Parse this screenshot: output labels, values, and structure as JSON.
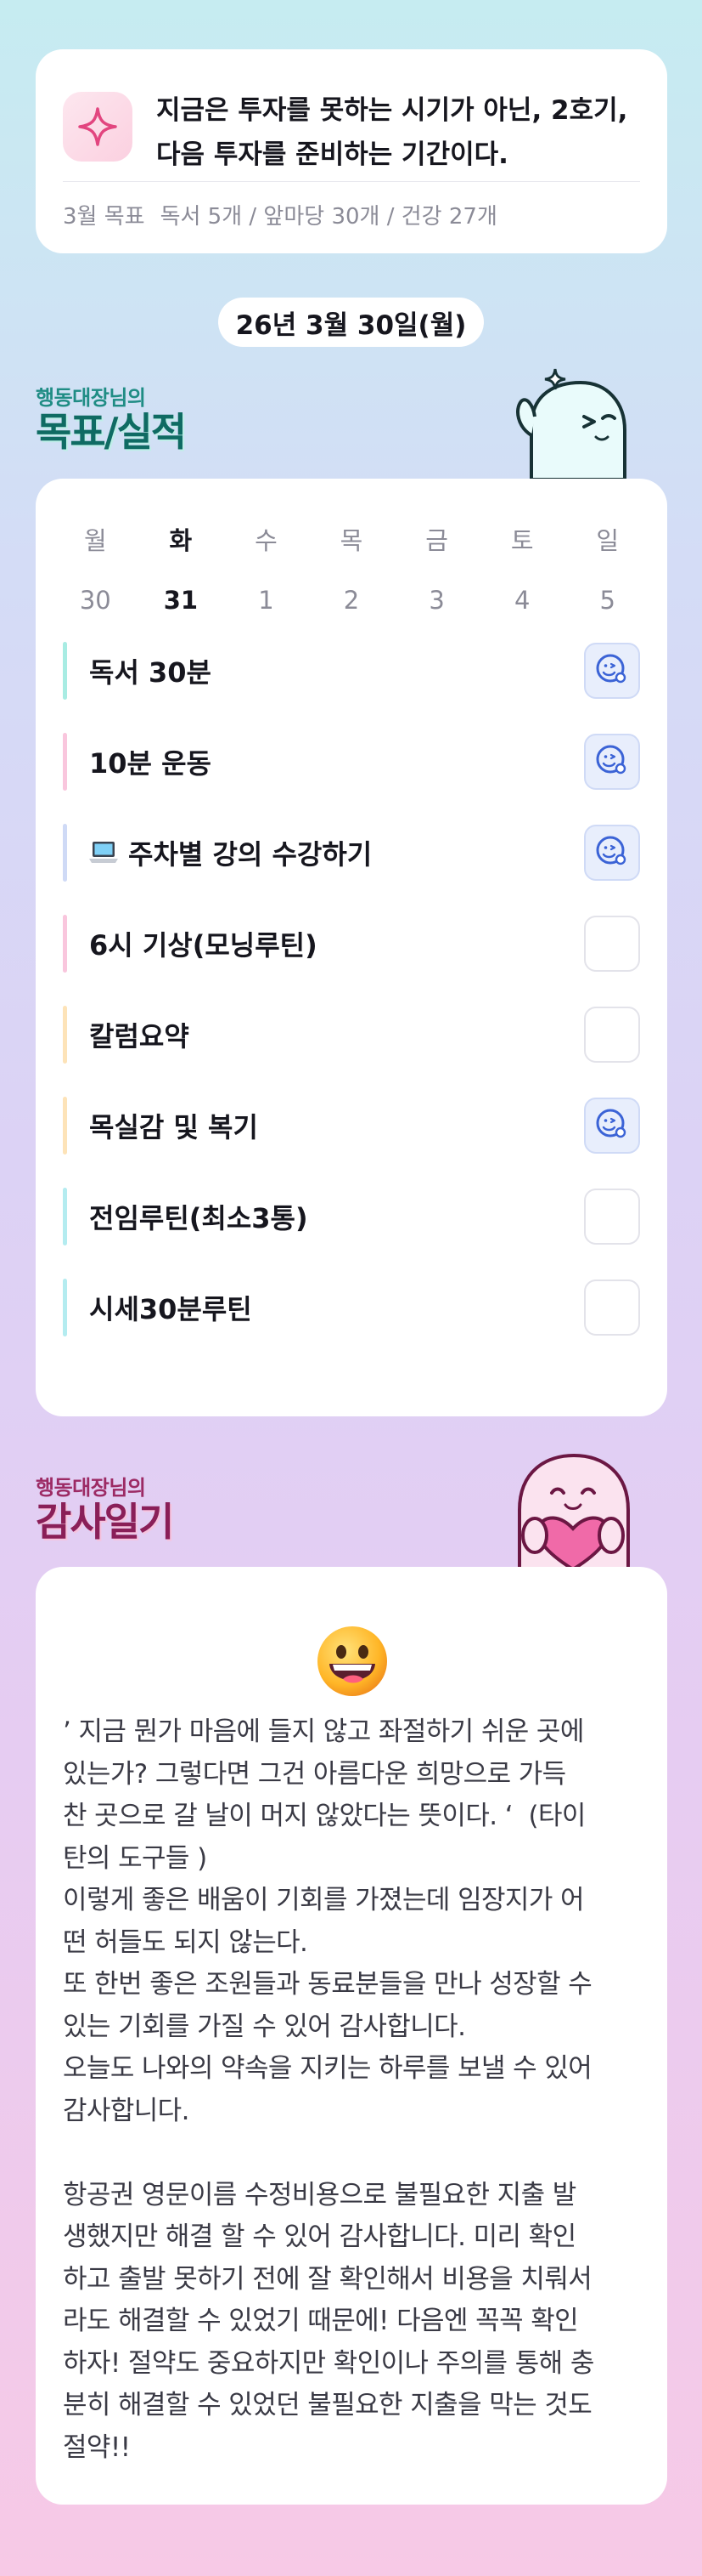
{
  "quote": {
    "text": "지금은 투자를 못하는 시기가 아닌, 2호기, 다음 투자를 준비하는 기간이다.",
    "goals_label": "3월 목표",
    "goals_detail": "독서 5개 / 앞마당 30개 / 건강 27개",
    "icon": "sparkle-icon"
  },
  "date_label": "26년 3월 30일(월)",
  "goals_section": {
    "subtitle": "행동대장님의",
    "title": "목표/실적"
  },
  "week": {
    "days": [
      "월",
      "화",
      "수",
      "목",
      "금",
      "토",
      "일"
    ],
    "dates": [
      "30",
      "31",
      "1",
      "2",
      "3",
      "4",
      "5"
    ],
    "today_index": 1
  },
  "tasks": [
    {
      "label": "독서 30분",
      "color": "#a8ece3",
      "done": true
    },
    {
      "label": "10분 운동",
      "color": "#f9c6dd",
      "done": true
    },
    {
      "label": "주차별 강의 수강하기",
      "icon": "laptop-icon",
      "color": "#cfdaf6",
      "done": true
    },
    {
      "label": "6시 기상(모닝루틴)",
      "color": "#f9c6dd",
      "done": false
    },
    {
      "label": "칼럼요약",
      "color": "#fde3b8",
      "done": false
    },
    {
      "label": "목실감 및 복기",
      "color": "#fde3b8",
      "done": true
    },
    {
      "label": "전임루틴(최소3통)",
      "color": "#b4ecf0",
      "done": false
    },
    {
      "label": "시세30분루틴",
      "color": "#b4ecf0",
      "done": false
    }
  ],
  "thanks_section": {
    "subtitle": "행동대장님의",
    "title": "감사일기"
  },
  "diary": {
    "emoji": "grinning-face-icon",
    "text": "’ 지금 뭔가 마음에 들지 않고 좌절하기 쉬운 곳에\n있는가? 그렇다면 그건 아름다운 희망으로 가득\n찬 곳으로 갈 날이 머지 않았다는 뜻이다. ‘  (타이\n탄의 도구들 )\n이렇게 좋은 배움이 기회를 가졌는데 임장지가 어\n떤 허들도 되지 않는다.\n또 한번 좋은 조원들과 동료분들을 만나 성장할 수\n있는 기회를 가질 수 있어 감사합니다.\n오늘도 나와의 약속을 지키는 하루를 보낼 수 있어\n감사합니다.\n\n항공권 영문이름 수정비용으로 불필요한 지출 발\n생했지만 해결 할 수 있어 감사합니다. 미리 확인\n하고 출발 못하기 전에 잘 확인해서 비용을 치뤄서\n라도 해결할 수 있었기 때문에! 다음엔 꼭꼭 확인\n하자! 절약도 중요하지만 확인이나 주의를 통해 충\n분히 해결할 수 있었던 불필요한 지출을 막는 것도\n절약!!"
  },
  "colors": {
    "check_done_bg": "#e8eefc",
    "check_icon": "#3b63d6",
    "goals_title": "#0f6b63",
    "thanks_title": "#8a1f58"
  }
}
